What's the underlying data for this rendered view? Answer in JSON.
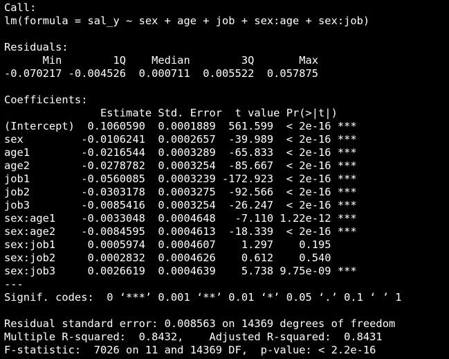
{
  "console_lines": [
    "Call:",
    "lm(formula = sal_y ~ sex + age + job + sex:age + sex:job)",
    "",
    "Residuals:",
    "      Min        1Q    Median        3Q       Max ",
    "-0.070217 -0.004526  0.000711  0.005522  0.057875 ",
    "",
    "Coefficients:",
    "               Estimate Std. Error  t value Pr(>|t|)    ",
    "(Intercept)  0.1060590  0.0001889  561.599  < 2e-16 ***",
    "sex         -0.0106241  0.0002657  -39.989  < 2e-16 ***",
    "age1        -0.0216544  0.0003289  -65.833  < 2e-16 ***",
    "age2        -0.0278782  0.0003254  -85.667  < 2e-16 ***",
    "job1        -0.0560085  0.0003239 -172.923  < 2e-16 ***",
    "job2        -0.0303178  0.0003275  -92.566  < 2e-16 ***",
    "job3        -0.0085416  0.0003254  -26.247  < 2e-16 ***",
    "sex:age1    -0.0033048  0.0004648   -7.110 1.22e-12 ***",
    "sex:age2    -0.0084595  0.0004613  -18.339  < 2e-16 ***",
    "sex:job1     0.0005974  0.0004607    1.297    0.195    ",
    "sex:job2     0.0002832  0.0004626    0.612    0.540    ",
    "sex:job3     0.0026619  0.0004639    5.738 9.75e-09 ***",
    "---",
    "Signif. codes:  0 ‘***’ 0.001 ‘**’ 0.01 ‘*’ 0.05 ‘.’ 0.1 ‘ ’ 1",
    "",
    "Residual standard error: 0.008563 on 14369 degrees of freedom",
    "Multiple R-squared:  0.8432,    Adjusted R-squared:  0.8431 ",
    "F-statistic:  7026 on 11 and 14369 DF,  p-value: < 2.2e-16"
  ]
}
